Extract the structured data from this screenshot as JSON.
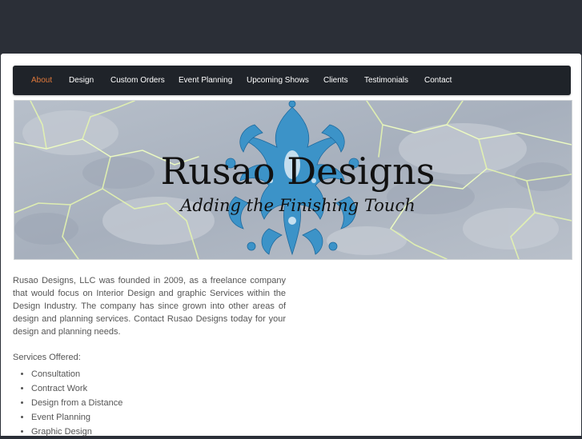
{
  "nav": {
    "items": [
      {
        "label": "About",
        "active": true
      },
      {
        "label": "Design",
        "active": false
      },
      {
        "label": "Custom Orders",
        "active": false
      },
      {
        "label": "Event Planning",
        "active": false
      },
      {
        "label": "Upcoming Shows",
        "active": false
      },
      {
        "label": "Clients",
        "active": false
      },
      {
        "label": "Testimonials",
        "active": false
      },
      {
        "label": "Contact",
        "active": false
      }
    ]
  },
  "banner": {
    "title": "Rusao Designs",
    "tagline": "Adding the Finishing Touch"
  },
  "main": {
    "intro": "Rusao Designs, LLC was founded in 2009, as a freelance company that would focus on Interior Design and graphic Services within the Design Industry. The company has since grown into other areas of design and planning services. Contact Rusao Designs today for your design and planning needs.",
    "services_heading": "Services Offered:",
    "services": [
      "Consultation",
      "Contract Work",
      "Design from a Distance",
      "Event Planning",
      "Graphic Design"
    ]
  },
  "colors": {
    "nav_bg": "#1f2329",
    "nav_active": "#e0783a",
    "nav_text": "#ffffff",
    "page_bg": "#2b2f37",
    "damask_blue": "#3c93c8",
    "crack_green": "#e4f4b0"
  }
}
